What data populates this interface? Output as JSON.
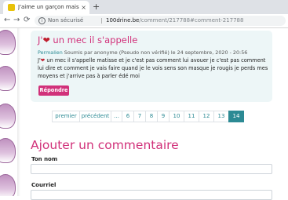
{
  "browser": {
    "tab_title": "J'aime un garçon mais je ne sais pas",
    "tab_close": "×",
    "new_tab": "+",
    "back": "←",
    "forward": "→",
    "reload": "⟳",
    "security_label": "Non sécurisé",
    "url_host": "100drine.be",
    "url_path": "/comment/217788#comment-217788"
  },
  "comment": {
    "title_prefix": "J'",
    "title_heart": "❤",
    "title_rest": " un mec il s'appelle",
    "permalink": "Permalien",
    "meta": " Soumis par anonyme (Pseudo non vérifié) le 24 septembre, 2020 - 20:56",
    "body_prefix": "J'",
    "body_heart": "❤",
    "body_rest": " un mec il s'appelle matisse et je c'est pas comment lui avouer je c'est pas comment lui dire et comment je vais faire quand je le vois sens son masque je rougis je perds mes moyens et j'arrive pas à parler édé moi",
    "reply_label": "Répondre"
  },
  "pagination": {
    "first": "premier",
    "previous": "précédent",
    "ellipsis": "…",
    "pages": [
      "6",
      "7",
      "8",
      "9",
      "10",
      "11",
      "12",
      "13",
      "14"
    ],
    "current": "14"
  },
  "form": {
    "title": "Ajouter un commentaire",
    "name_label": "Ton nom",
    "email_label": "Courriel"
  },
  "colors": {
    "accent": "#d1317a",
    "link": "#2c8a94",
    "card_bg": "#edf6f7"
  }
}
